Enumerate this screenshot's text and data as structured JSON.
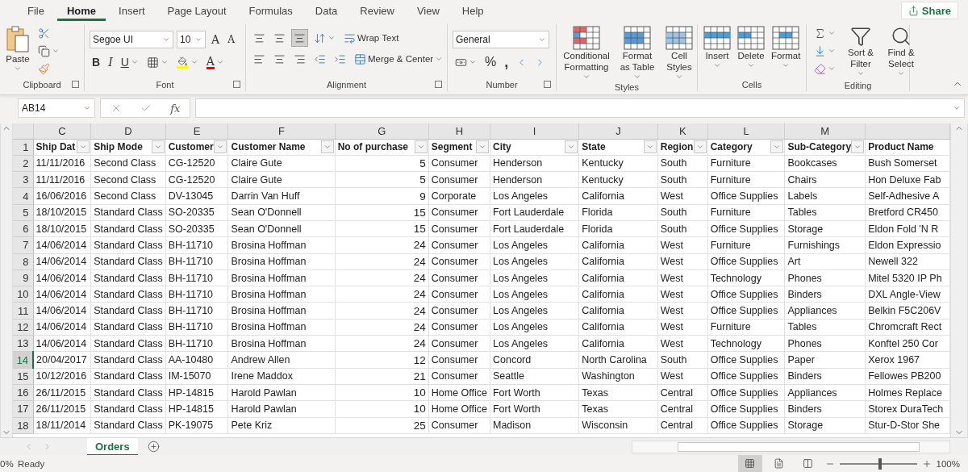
{
  "menu_tabs": [
    {
      "label": "File",
      "selected": false
    },
    {
      "label": "Home",
      "selected": true
    },
    {
      "label": "Insert",
      "selected": false
    },
    {
      "label": "Page Layout",
      "selected": false
    },
    {
      "label": "Formulas",
      "selected": false
    },
    {
      "label": "Data",
      "selected": false
    },
    {
      "label": "Review",
      "selected": false
    },
    {
      "label": "View",
      "selected": false
    },
    {
      "label": "Help",
      "selected": false
    }
  ],
  "share": "Share",
  "ribbon": {
    "clipboard": {
      "label": "Clipboard",
      "paste": "Paste"
    },
    "font": {
      "label": "Font",
      "font_name": "Segoe UI",
      "font_size": "10",
      "grow": "A",
      "shrink": "A",
      "bold": "B",
      "italic": "I",
      "underline": "U",
      "font_color": "A"
    },
    "alignment": {
      "label": "Alignment",
      "vertical_align": [
        {
          "selected": false
        },
        {
          "selected": false
        },
        {
          "selected": true
        }
      ],
      "wrap_text": "Wrap Text",
      "merge": "Merge & Center"
    },
    "number": {
      "label": "Number",
      "format": "General",
      "percent": "%",
      "comma": ","
    },
    "styles": {
      "label": "Styles",
      "buttons": [
        "Conditional Formatting",
        "Format as Table",
        "Cell Styles"
      ]
    },
    "cells": {
      "label": "Cells",
      "buttons": [
        "Insert",
        "Delete",
        "Format"
      ]
    },
    "editing": {
      "label": "Editing",
      "buttons": [
        "Sort & Filter",
        "Find & Select"
      ]
    }
  },
  "formula_bar": {
    "name_box": "AB14",
    "fx": "fx"
  },
  "sheet": {
    "columns": [
      {
        "letter": "C",
        "header": "Ship Dat",
        "kind": "text"
      },
      {
        "letter": "D",
        "header": "Ship Mode",
        "kind": "text"
      },
      {
        "letter": "E",
        "header": "Customer",
        "kind": "text"
      },
      {
        "letter": "F",
        "header": "Customer Name",
        "kind": "text"
      },
      {
        "letter": "G",
        "header": "No of purchase",
        "kind": "number"
      },
      {
        "letter": "H",
        "header": "Segment",
        "kind": "text"
      },
      {
        "letter": "I",
        "header": "City",
        "kind": "text"
      },
      {
        "letter": "J",
        "header": "State",
        "kind": "text"
      },
      {
        "letter": "K",
        "header": "Region",
        "kind": "text"
      },
      {
        "letter": "L",
        "header": "Category",
        "kind": "text"
      },
      {
        "letter": "M",
        "header": "Sub-Category",
        "kind": "text"
      },
      {
        "header": "Product Name",
        "kind": "text"
      }
    ],
    "header_row": "1",
    "rows": [
      {
        "number": "2",
        "selected": false,
        "cells": [
          "11/11/2016",
          "Second Class",
          "CG-12520",
          "Claire Gute",
          "5",
          "Consumer",
          "Henderson",
          "Kentucky",
          "South",
          "Furniture",
          "Bookcases",
          "Bush Somerset"
        ]
      },
      {
        "number": "3",
        "selected": false,
        "cells": [
          "11/11/2016",
          "Second Class",
          "CG-12520",
          "Claire Gute",
          "5",
          "Consumer",
          "Henderson",
          "Kentucky",
          "South",
          "Furniture",
          "Chairs",
          "Hon Deluxe Fab"
        ]
      },
      {
        "number": "4",
        "selected": false,
        "cells": [
          "16/06/2016",
          "Second Class",
          "DV-13045",
          "Darrin Van Huff",
          "9",
          "Corporate",
          "Los Angeles",
          "California",
          "West",
          "Office Supplies",
          "Labels",
          "Self-Adhesive A"
        ]
      },
      {
        "number": "5",
        "selected": false,
        "cells": [
          "18/10/2015",
          "Standard Class",
          "SO-20335",
          "Sean O'Donnell",
          "15",
          "Consumer",
          "Fort Lauderdale",
          "Florida",
          "South",
          "Furniture",
          "Tables",
          "Bretford CR450"
        ]
      },
      {
        "number": "6",
        "selected": false,
        "cells": [
          "18/10/2015",
          "Standard Class",
          "SO-20335",
          "Sean O'Donnell",
          "15",
          "Consumer",
          "Fort Lauderdale",
          "Florida",
          "South",
          "Office Supplies",
          "Storage",
          "Eldon Fold 'N R"
        ]
      },
      {
        "number": "7",
        "selected": false,
        "cells": [
          "14/06/2014",
          "Standard Class",
          "BH-11710",
          "Brosina Hoffman",
          "24",
          "Consumer",
          "Los Angeles",
          "California",
          "West",
          "Furniture",
          "Furnishings",
          "Eldon Expressio"
        ]
      },
      {
        "number": "8",
        "selected": false,
        "cells": [
          "14/06/2014",
          "Standard Class",
          "BH-11710",
          "Brosina Hoffman",
          "24",
          "Consumer",
          "Los Angeles",
          "California",
          "West",
          "Office Supplies",
          "Art",
          "Newell 322"
        ]
      },
      {
        "number": "9",
        "selected": false,
        "cells": [
          "14/06/2014",
          "Standard Class",
          "BH-11710",
          "Brosina Hoffman",
          "24",
          "Consumer",
          "Los Angeles",
          "California",
          "West",
          "Technology",
          "Phones",
          "Mitel 5320 IP Ph"
        ]
      },
      {
        "number": "10",
        "selected": false,
        "cells": [
          "14/06/2014",
          "Standard Class",
          "BH-11710",
          "Brosina Hoffman",
          "24",
          "Consumer",
          "Los Angeles",
          "California",
          "West",
          "Office Supplies",
          "Binders",
          "DXL Angle-View"
        ]
      },
      {
        "number": "11",
        "selected": false,
        "cells": [
          "14/06/2014",
          "Standard Class",
          "BH-11710",
          "Brosina Hoffman",
          "24",
          "Consumer",
          "Los Angeles",
          "California",
          "West",
          "Office Supplies",
          "Appliances",
          "Belkin F5C206V"
        ]
      },
      {
        "number": "12",
        "selected": false,
        "cells": [
          "14/06/2014",
          "Standard Class",
          "BH-11710",
          "Brosina Hoffman",
          "24",
          "Consumer",
          "Los Angeles",
          "California",
          "West",
          "Furniture",
          "Tables",
          "Chromcraft Rect"
        ]
      },
      {
        "number": "13",
        "selected": false,
        "cells": [
          "14/06/2014",
          "Standard Class",
          "BH-11710",
          "Brosina Hoffman",
          "24",
          "Consumer",
          "Los Angeles",
          "California",
          "West",
          "Technology",
          "Phones",
          "Konftel 250 Cor"
        ]
      },
      {
        "number": "14",
        "selected": true,
        "cells": [
          "20/04/2017",
          "Standard Class",
          "AA-10480",
          "Andrew Allen",
          "12",
          "Consumer",
          "Concord",
          "North Carolina",
          "South",
          "Office Supplies",
          "Paper",
          "Xerox 1967"
        ]
      },
      {
        "number": "15",
        "selected": false,
        "cells": [
          "10/12/2016",
          "Standard Class",
          "IM-15070",
          "Irene Maddox",
          "21",
          "Consumer",
          "Seattle",
          "Washington",
          "West",
          "Office Supplies",
          "Binders",
          "Fellowes PB200"
        ]
      },
      {
        "number": "16",
        "selected": false,
        "cells": [
          "26/11/2015",
          "Standard Class",
          "HP-14815",
          "Harold Pawlan",
          "10",
          "Home Office",
          "Fort Worth",
          "Texas",
          "Central",
          "Office Supplies",
          "Appliances",
          "Holmes Replace"
        ]
      },
      {
        "number": "17",
        "selected": false,
        "cells": [
          "26/11/2015",
          "Standard Class",
          "HP-14815",
          "Harold Pawlan",
          "10",
          "Home Office",
          "Fort Worth",
          "Texas",
          "Central",
          "Office Supplies",
          "Binders",
          "Storex DuraTech"
        ]
      },
      {
        "number": "18",
        "selected": false,
        "cells": [
          "18/11/2014",
          "Standard Class",
          "PK-19075",
          "Pete Kriz",
          "25",
          "Consumer",
          "Madison",
          "Wisconsin",
          "Central",
          "Office Supplies",
          "Storage",
          "Stur-D-Stor She"
        ]
      }
    ]
  },
  "sheet_tabs": [
    {
      "label": "Orders",
      "selected": true
    }
  ],
  "status": {
    "cut_text": "0%",
    "state": "Ready",
    "views": [
      {
        "selected": true
      },
      {
        "selected": false
      },
      {
        "selected": false
      }
    ],
    "zoom_slider": {
      "level": 0.5
    },
    "zoom": "100%"
  }
}
